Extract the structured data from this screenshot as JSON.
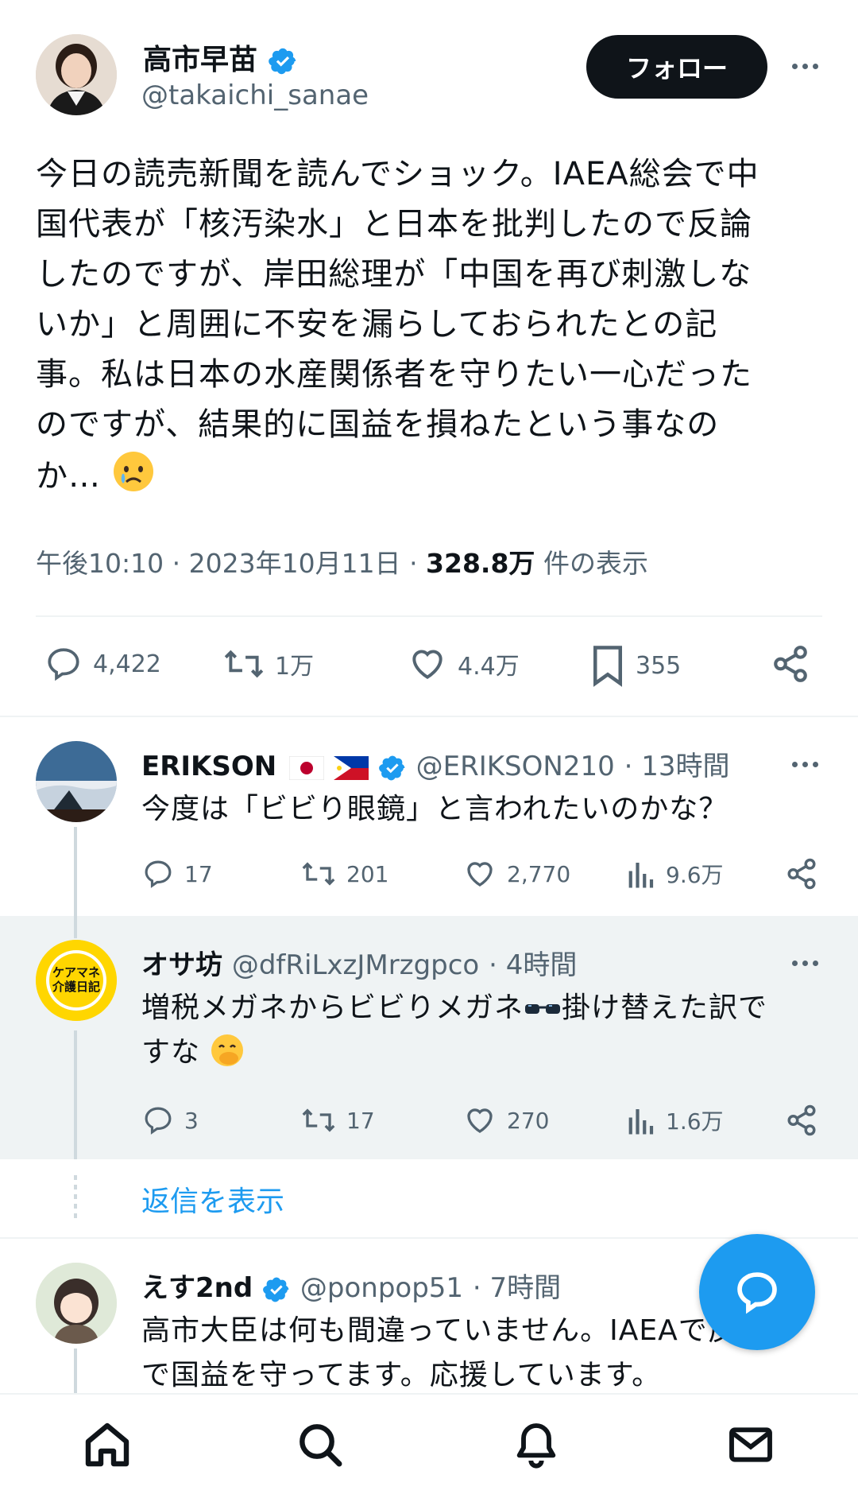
{
  "main_tweet": {
    "author_name": "高市早苗",
    "author_handle": "@takaichi_sanae",
    "follow_label": "フォロー",
    "text_lines": [
      "今日の読売新聞を読んでショック。IAEA総会で中",
      "国代表が「核汚染水」と日本を批判したので反論",
      "したのですが、岸田総理が「中国を再び刺激しな",
      "いか」と周囲に不安を漏らしておられたとの記",
      "事。私は日本の水産関係者を守りたい一心だった",
      "のですが、結果的に国益を損ねたという事なの",
      "か…"
    ],
    "time": "午後10:10",
    "date": "2023年10月11日",
    "views": "328.8万",
    "views_label": "件の表示",
    "stats": {
      "replies": "4,422",
      "retweets": "1万",
      "likes": "4.4万",
      "bookmarks": "355"
    }
  },
  "replies": [
    {
      "name": "ERIKSON",
      "handle": "@ERIKSON210",
      "time": "13時間",
      "text_lines": [
        "今度は「ビビり眼鏡」と言われたいのかな？"
      ],
      "stats": {
        "replies": "17",
        "retweets": "201",
        "likes": "2,770",
        "views": "9.6万"
      }
    },
    {
      "name": "オサ坊",
      "handle": "@dfRiLxzJMrzgpco",
      "time": "4時間",
      "avatar_text": "ケアマネ 介護日記",
      "text_lines": [
        "増税メガネからビビりメガネ",
        "掛け替えた訳で",
        "すな"
      ],
      "stats": {
        "replies": "3",
        "retweets": "17",
        "likes": "270",
        "views": "1.6万"
      }
    },
    {
      "name": "えす2nd",
      "handle": "@ponpop51",
      "time": "7時間",
      "text_lines": [
        "高市大臣は何も間違っていません。IAEAで反論",
        "で国益を守ってます。応援しています。"
      ]
    }
  ],
  "show_replies_label": "返信を表示",
  "colors": {
    "accent": "#1d9bf0",
    "text": "#0f1419",
    "muted": "#536471",
    "highlight_bg": "#eff3f4"
  },
  "icons": {
    "reply": "speech-bubble-icon",
    "retweet": "retweet-icon",
    "like": "heart-icon",
    "bookmark": "bookmark-icon",
    "share": "share-icon",
    "views": "bar-chart-icon",
    "verified": "verified-badge-icon"
  }
}
